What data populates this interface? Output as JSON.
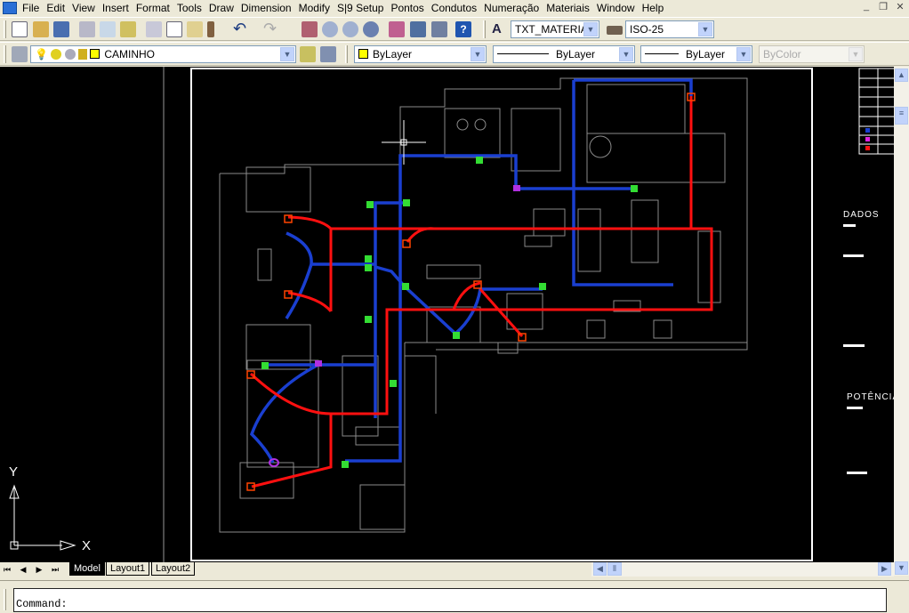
{
  "menubar": {
    "items": [
      "File",
      "Edit",
      "View",
      "Insert",
      "Format",
      "Tools",
      "Draw",
      "Dimension",
      "Modify",
      "S|9 Setup",
      "Pontos",
      "Condutos",
      "Numeração",
      "Materiais",
      "Window",
      "Help"
    ],
    "window_controls": {
      "minimize": "_",
      "restore": "❐",
      "close": "✕"
    }
  },
  "toolbar": {
    "standard_icons": [
      "new-icon",
      "open-icon",
      "save-icon",
      "print-icon",
      "plot-preview-icon",
      "publish-icon",
      "cut-icon",
      "copy-icon",
      "paste-icon",
      "match-properties-icon",
      "undo-icon",
      "redo-icon",
      "pan-icon",
      "zoom-realtime-icon",
      "zoom-window-icon",
      "zoom-previous-icon",
      "properties-icon",
      "design-center-icon",
      "tool-palettes-icon",
      "help-icon"
    ],
    "text_style": "TXT_MATERIA",
    "dim_style": "ISO-25"
  },
  "layers": {
    "current_layer": "CAMINHO",
    "color": "ByLayer",
    "linetype": "ByLayer",
    "lineweight": "ByLayer",
    "plot_style": "ByColor",
    "layer_color": "#ffff00"
  },
  "drawing": {
    "labels": {
      "dados": "DADOS",
      "potencia": "POTÊNCIA"
    },
    "ucs": {
      "x": "X",
      "y": "Y"
    },
    "colors": {
      "background": "#000000",
      "walls": "#8a8a8a",
      "data_conduit": "#1a3fd0",
      "power_conduit": "#ff1010",
      "outlet": "#33dd33",
      "junction": "#ff4400",
      "special": "#b030e0"
    }
  },
  "tabs": {
    "items": [
      "Model",
      "Layout1",
      "Layout2"
    ],
    "active": "Model"
  },
  "command": {
    "prompt": "Command:"
  }
}
